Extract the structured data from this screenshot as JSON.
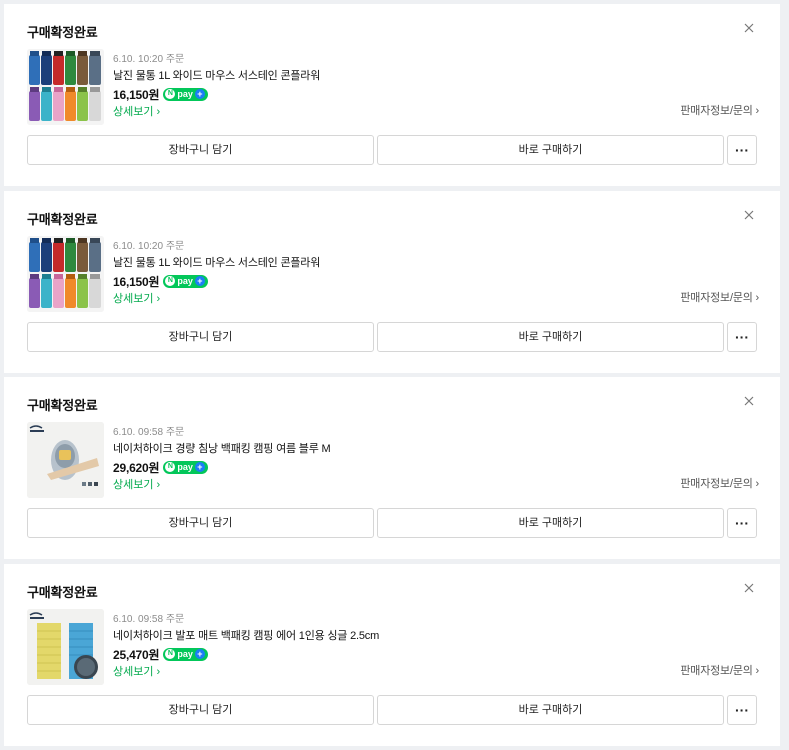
{
  "orders": [
    {
      "status": "구매확정완료",
      "date": "6.10. 10:20 주문",
      "name": "날진 물통 1L 와이드 마우스 서스테인 콘플라워",
      "price": "16,150원",
      "npay_pay": "pay",
      "npay_n": "N",
      "detail_label": "상세보기",
      "seller_label": "판매자정보/문의",
      "cart_label": "장바구니 담기",
      "buy_label": "바로 구매하기",
      "more_label": "···",
      "thumb": "bottles"
    },
    {
      "status": "구매확정완료",
      "date": "6.10. 10:20 주문",
      "name": "날진 물통 1L 와이드 마우스 서스테인 콘플라워",
      "price": "16,150원",
      "npay_pay": "pay",
      "npay_n": "N",
      "detail_label": "상세보기",
      "seller_label": "판매자정보/문의",
      "cart_label": "장바구니 담기",
      "buy_label": "바로 구매하기",
      "more_label": "···",
      "thumb": "bottles"
    },
    {
      "status": "구매확정완료",
      "date": "6.10. 09:58 주문",
      "name": "네이처하이크 경량 침낭 백패킹 캠핑 여름 블루 M",
      "price": "29,620원",
      "npay_pay": "pay",
      "npay_n": "N",
      "detail_label": "상세보기",
      "seller_label": "판매자정보/문의",
      "cart_label": "장바구니 담기",
      "buy_label": "바로 구매하기",
      "more_label": "···",
      "thumb": "sleeping-bag"
    },
    {
      "status": "구매확정완료",
      "date": "6.10. 09:58 주문",
      "name": "네이처하이크 발포 매트 백패킹 캠핑 에어 1인용 싱글 2.5cm",
      "price": "25,470원",
      "npay_pay": "pay",
      "npay_n": "N",
      "detail_label": "상세보기",
      "seller_label": "판매자정보/문의",
      "cart_label": "장바구니 담기",
      "buy_label": "바로 구매하기",
      "more_label": "···",
      "thumb": "foam-mat"
    }
  ],
  "icons": {
    "close": "close-icon",
    "chevron": "chevron-right-icon"
  },
  "colors": {
    "green": "#03c75a",
    "blue": "#1d7df6"
  }
}
